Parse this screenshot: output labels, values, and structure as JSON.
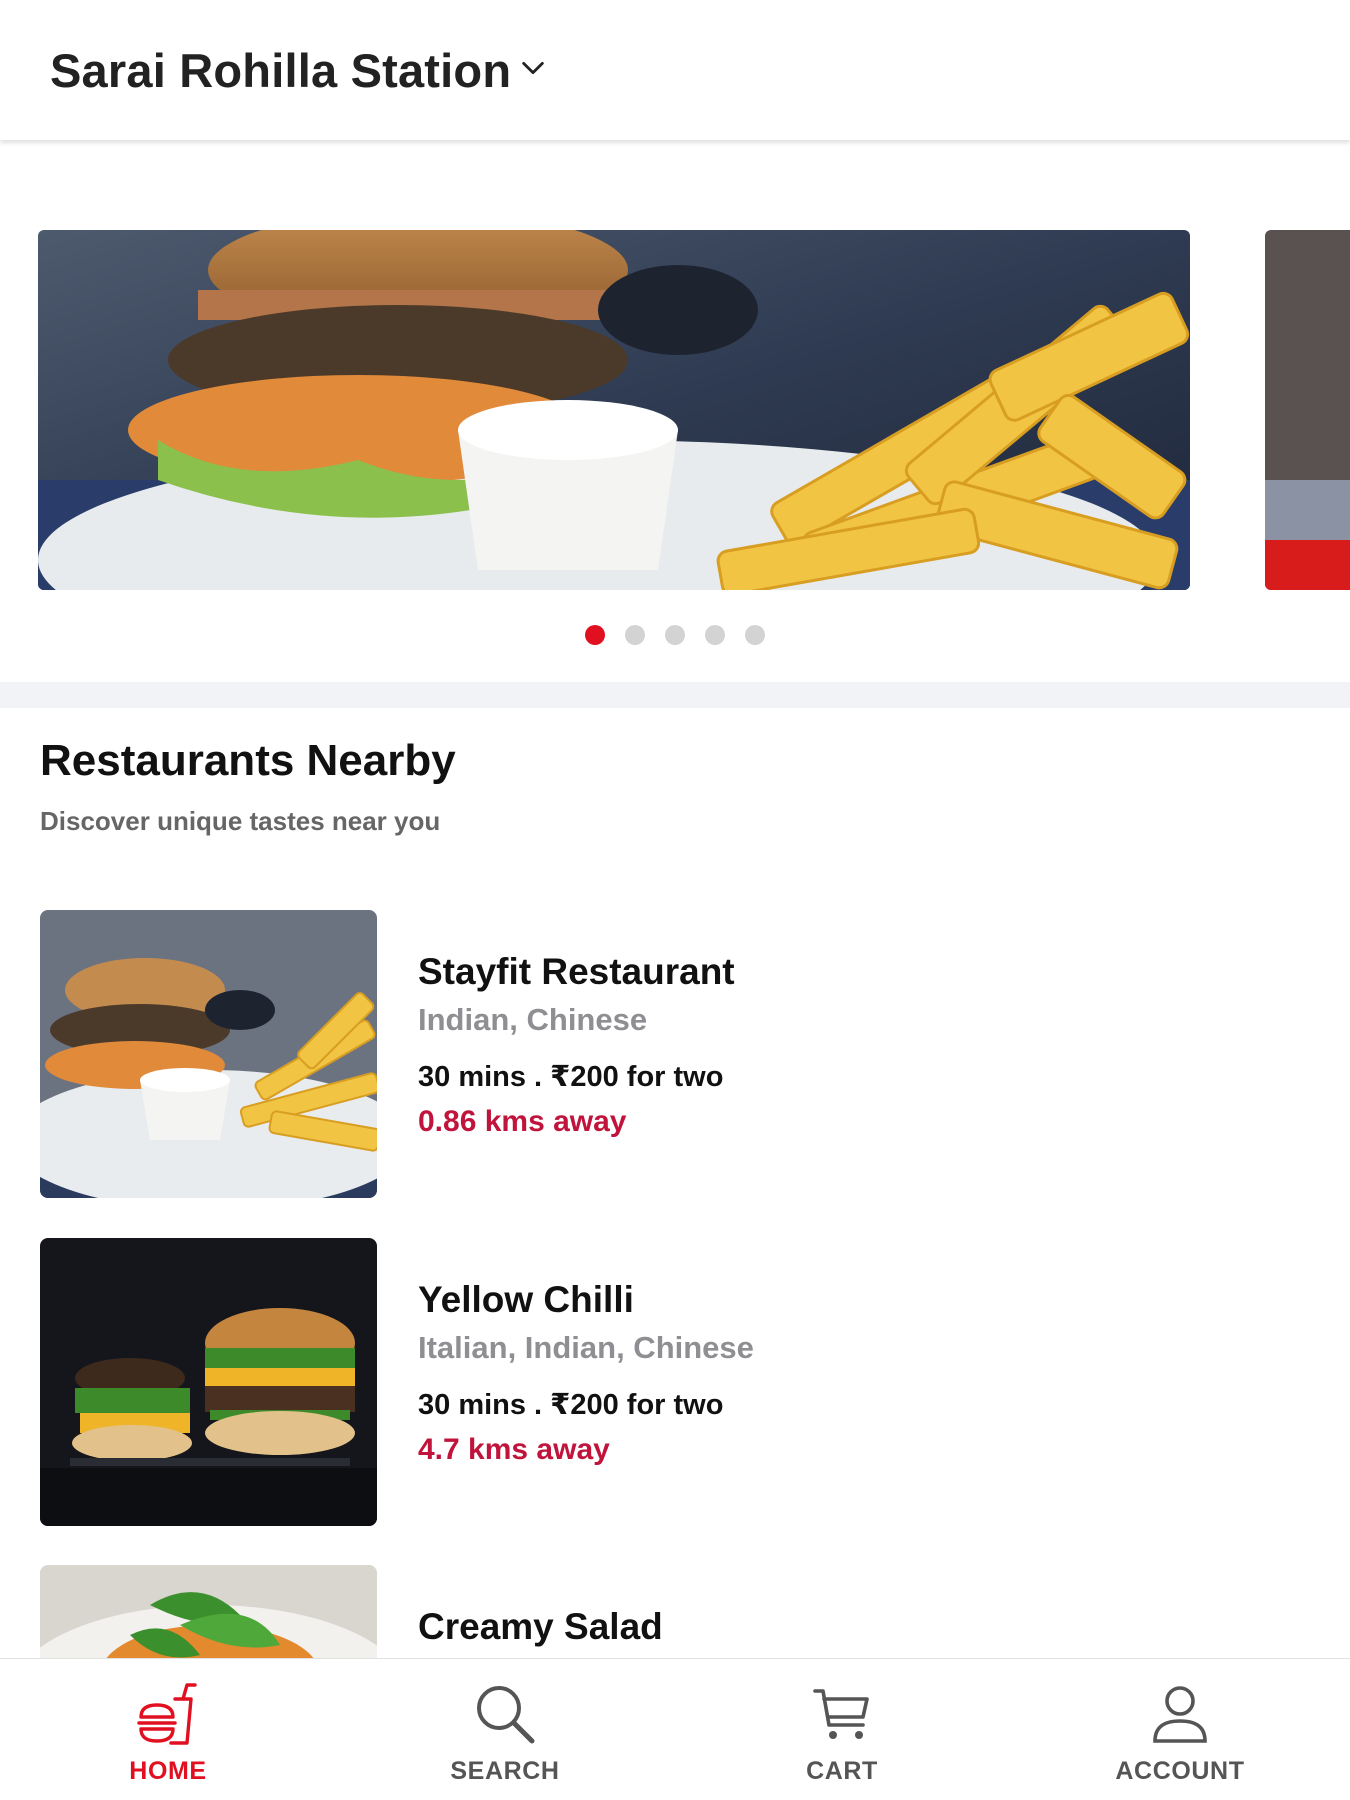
{
  "header": {
    "location": "Sarai Rohilla Station"
  },
  "carousel": {
    "active_index": 0,
    "dot_count": 5
  },
  "section": {
    "title": "Restaurants Nearby",
    "subtitle": "Discover unique tastes near you"
  },
  "restaurants": [
    {
      "name": "Stayfit Restaurant",
      "cuisine": "Indian, Chinese",
      "meta": "30 mins . ₹200 for two",
      "distance": "0.86 kms away"
    },
    {
      "name": "Yellow Chilli",
      "cuisine": "Italian, Indian, Chinese",
      "meta": "30 mins . ₹200 for two",
      "distance": "4.7 kms away"
    },
    {
      "name": "Creamy Salad"
    }
  ],
  "nav": {
    "home": {
      "label": "HOME",
      "icon": "burger-drink-icon"
    },
    "search": {
      "label": "SEARCH",
      "icon": "search-icon"
    },
    "cart": {
      "label": "CART",
      "icon": "cart-icon"
    },
    "account": {
      "label": "ACCOUNT",
      "icon": "user-icon"
    }
  },
  "colors": {
    "accent": "#e11020",
    "distance": "#c0143c",
    "muted": "#8e8e93"
  }
}
